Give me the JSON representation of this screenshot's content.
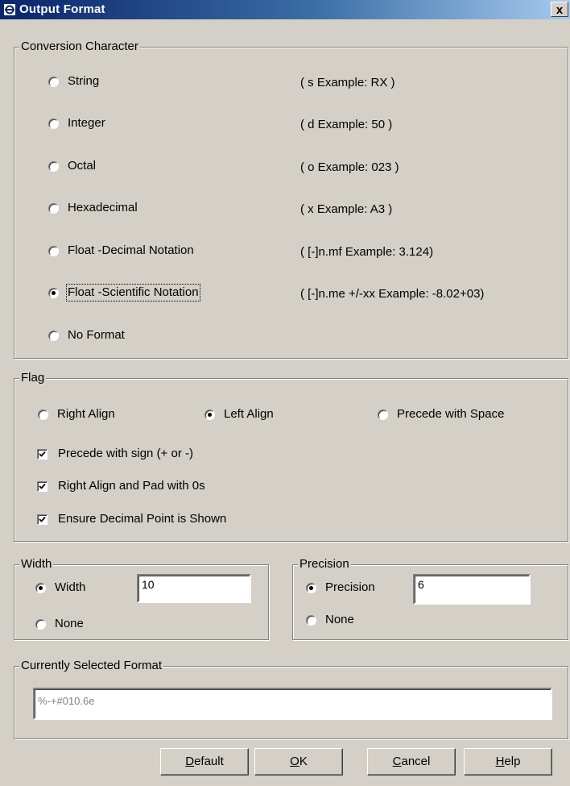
{
  "window": {
    "title": "Output Format",
    "close_label": "x"
  },
  "conversion": {
    "legend": "Conversion Character",
    "options": [
      {
        "label": "String",
        "example": "( s Example: RX )",
        "selected": false
      },
      {
        "label": "Integer",
        "example": "( d Example: 50 )",
        "selected": false
      },
      {
        "label": "Octal",
        "example": "( o Example: 023 )",
        "selected": false
      },
      {
        "label": "Hexadecimal",
        "example": "( x Example: A3 )",
        "selected": false
      },
      {
        "label": "Float -Decimal Notation",
        "example": "( [-]n.mf Example: 3.124)",
        "selected": false
      },
      {
        "label": "Float -Scientific Notation",
        "example": "( [-]n.me +/-xx Example: -8.02+03)",
        "selected": true
      },
      {
        "label": "No Format",
        "example": "",
        "selected": false
      }
    ]
  },
  "flag": {
    "legend": "Flag",
    "align_options": [
      {
        "label": "Right Align",
        "selected": false
      },
      {
        "label": "Left Align",
        "selected": true
      },
      {
        "label": "Precede with Space",
        "selected": false
      }
    ],
    "checkboxes": [
      {
        "label": "Precede with sign (+ or -)",
        "checked": true
      },
      {
        "label": "Right Align and Pad with 0s",
        "checked": true
      },
      {
        "label": "Ensure Decimal Point is Shown",
        "checked": true
      }
    ]
  },
  "width": {
    "legend": "Width",
    "width_label": "Width",
    "width_value": "10",
    "none_label": "None",
    "width_selected": true
  },
  "precision": {
    "legend": "Precision",
    "precision_label": "Precision",
    "precision_value": "6",
    "none_label": "None",
    "precision_selected": true
  },
  "current": {
    "legend": "Currently Selected Format",
    "value": "%-+#010.6e"
  },
  "buttons": {
    "default": {
      "mnemonic": "D",
      "rest": "efault"
    },
    "ok": {
      "mnemonic": "O",
      "rest": "K"
    },
    "cancel": {
      "mnemonic": "C",
      "rest": "ancel"
    },
    "help": {
      "mnemonic": "H",
      "rest": "elp"
    }
  },
  "colors": {
    "dialog_bg": "#d4d0c8",
    "title_bar_start": "#0a246a",
    "title_bar_end": "#a6caf0"
  }
}
